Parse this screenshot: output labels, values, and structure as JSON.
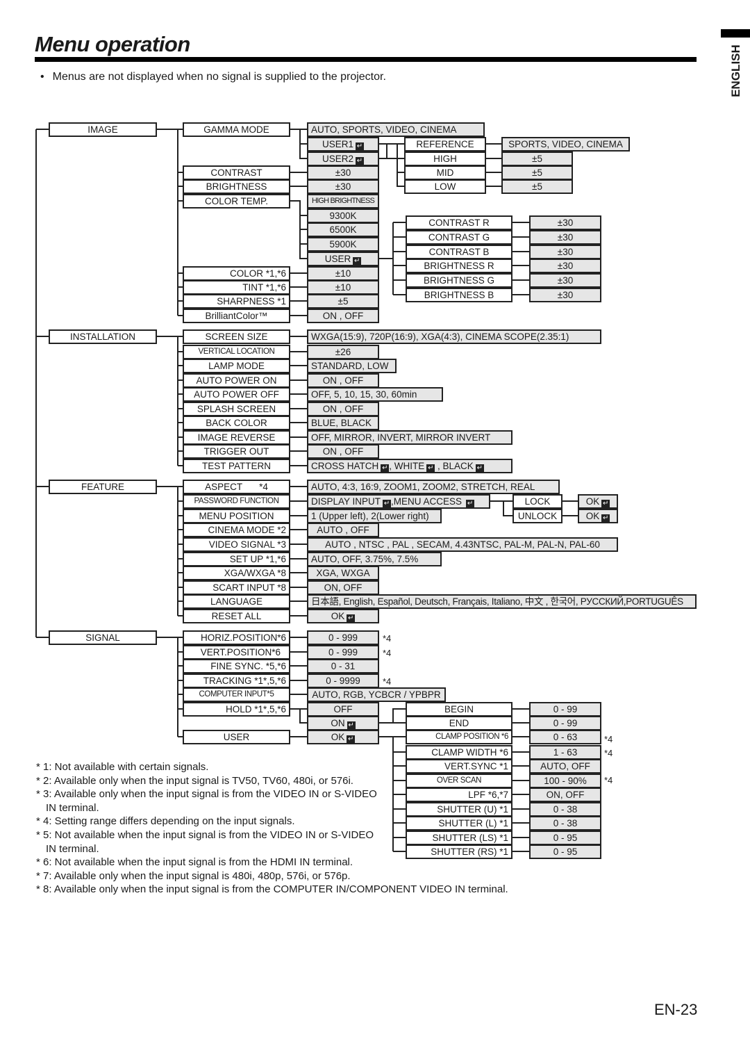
{
  "page": {
    "title": "Menu operation",
    "language_tab": "ENGLISH",
    "intro_bullet": "•",
    "intro": "Menus are not displayed when no signal is supplied to the projector.",
    "page_number": "EN-23",
    "enter_icon": "↵"
  },
  "menus": {
    "image": {
      "label": "IMAGE",
      "items": [
        {
          "label": "GAMMA MODE",
          "value": "AUTO, SPORTS, VIDEO, CINEMA"
        },
        {
          "label": "",
          "value": "USER1"
        },
        {
          "label": "",
          "value": "USER2"
        },
        {
          "label": "CONTRAST",
          "value": "±30"
        },
        {
          "label": "BRIGHTNESS",
          "value": "±30"
        },
        {
          "label": "COLOR TEMP.",
          "value": "HIGH BRIGHTNESS"
        },
        {
          "label": "",
          "value": "9300K"
        },
        {
          "label": "",
          "value": "6500K"
        },
        {
          "label": "",
          "value": "5900K"
        },
        {
          "label": "",
          "value": "USER"
        },
        {
          "label": "COLOR   *1,*6",
          "value": "±10"
        },
        {
          "label": "TINT      *1,*6",
          "value": "±10"
        },
        {
          "label": "SHARPNESS  *1",
          "value": "±5"
        },
        {
          "label": "BrilliantColor™",
          "value": "ON , OFF"
        }
      ],
      "gamma_user": [
        {
          "label": "REFERENCE",
          "value": "SPORTS, VIDEO, CINEMA"
        },
        {
          "label": "HIGH",
          "value": "±5"
        },
        {
          "label": "MID",
          "value": "±5"
        },
        {
          "label": "LOW",
          "value": "±5"
        }
      ],
      "color_temp_user": [
        {
          "label": "CONTRAST R",
          "value": "±30"
        },
        {
          "label": "CONTRAST G",
          "value": "±30"
        },
        {
          "label": "CONTRAST B",
          "value": "±30"
        },
        {
          "label": "BRIGHTNESS R",
          "value": "±30"
        },
        {
          "label": "BRIGHTNESS G",
          "value": "±30"
        },
        {
          "label": "BRIGHTNESS B",
          "value": "±30"
        }
      ]
    },
    "installation": {
      "label": "INSTALLATION",
      "items": [
        {
          "label": "SCREEN SIZE",
          "value": "WXGA(15:9), 720P(16:9), XGA(4:3), CINEMA SCOPE(2.35:1)"
        },
        {
          "label": "VERTICAL LOCATION",
          "value": "±26"
        },
        {
          "label": "LAMP MODE",
          "value": "STANDARD, LOW"
        },
        {
          "label": "AUTO POWER ON",
          "value": "ON , OFF"
        },
        {
          "label": "AUTO POWER OFF",
          "value": "OFF,  5,  10,  15,  30,  60min"
        },
        {
          "label": "SPLASH SCREEN",
          "value": "ON , OFF"
        },
        {
          "label": "BACK COLOR",
          "value": "BLUE, BLACK"
        },
        {
          "label": "IMAGE REVERSE",
          "value": "OFF, MIRROR, INVERT, MIRROR INVERT"
        },
        {
          "label": "TRIGGER OUT",
          "value": "ON , OFF"
        },
        {
          "label": "TEST PATTERN",
          "value_parts": [
            "CROSS HATCH",
            ", WHITE",
            " , BLACK"
          ]
        }
      ]
    },
    "feature": {
      "label": "FEATURE",
      "items": [
        {
          "label": "ASPECT",
          "note": "*4",
          "value": "AUTO, 4:3, 16:9, ZOOM1, ZOOM2, STRETCH, REAL"
        },
        {
          "label": "PASSWORD FUNCTION",
          "value_parts": [
            "DISPLAY INPUT",
            ",MENU ACCESS"
          ]
        },
        {
          "label": "MENU POSITION",
          "value": "1 (Upper left), 2(Lower right)"
        },
        {
          "label": "CINEMA MODE *2",
          "value": "AUTO , OFF"
        },
        {
          "label": "VIDEO SIGNAL *3",
          "value": "AUTO , NTSC , PAL , SECAM, 4.43NTSC, PAL-M, PAL-N, PAL-60"
        },
        {
          "label": "SET UP   *1,*6",
          "value": "AUTO, OFF, 3.75%, 7.5%"
        },
        {
          "label": "XGA/WXGA  *8",
          "value": "XGA, WXGA"
        },
        {
          "label": "SCART INPUT *8",
          "value": "ON, OFF"
        },
        {
          "label": "LANGUAGE",
          "value": "日本語, English, Español, Deutsch, Français, Italiano, 中文 , 한국어, РУССКИЙ,PORTUGUÊS"
        },
        {
          "label": "RESET ALL",
          "value": "OK"
        }
      ],
      "password": [
        {
          "label": "LOCK",
          "value": "OK"
        },
        {
          "label": "UNLOCK",
          "value": "OK"
        }
      ]
    },
    "signal": {
      "label": "SIGNAL",
      "items": [
        {
          "label": "HORIZ.POSITION*6",
          "value": "0 - 999",
          "note": "*4"
        },
        {
          "label": "VERT.POSITION*6",
          "value": "0 - 999",
          "note": "*4"
        },
        {
          "label": "FINE SYNC. *5,*6",
          "value": "0 - 31",
          "note": ""
        },
        {
          "label": "TRACKING *1*,5,*6",
          "value": "0 - 9999",
          "note": "*4"
        },
        {
          "label": "COMPUTER INPUT*5",
          "value": "AUTO, RGB, YCBCR / YPBPR"
        },
        {
          "label": "HOLD *1*,5,*6",
          "value": "OFF"
        },
        {
          "label": "",
          "value": "ON"
        },
        {
          "label": "USER",
          "value": "OK"
        }
      ],
      "user_items": [
        {
          "label": "BEGIN",
          "value": "0 - 99",
          "note": ""
        },
        {
          "label": "END",
          "value": "0 - 99",
          "note": ""
        },
        {
          "label": "CLAMP POSITION *6",
          "value": "0 - 63",
          "note": "*4"
        },
        {
          "label": "CLAMP WIDTH *6",
          "value": "1 - 63",
          "note": "*4"
        },
        {
          "label": "VERT.SYNC     *1",
          "value": "AUTO, OFF",
          "note": ""
        },
        {
          "label": "OVER SCAN",
          "value": "100 - 90%",
          "note": "*4"
        },
        {
          "label": "LPF        *6,*7",
          "value": "ON, OFF",
          "note": ""
        },
        {
          "label": "SHUTTER (U)   *1",
          "value": "0 - 38",
          "note": ""
        },
        {
          "label": "SHUTTER (L)   *1",
          "value": "0 - 38",
          "note": ""
        },
        {
          "label": "SHUTTER (LS)  *1",
          "value": "0 - 95",
          "note": ""
        },
        {
          "label": "SHUTTER (RS)  *1",
          "value": "0 - 95",
          "note": ""
        }
      ]
    }
  },
  "footnotes": [
    "* 1: Not available with certain signals.",
    "* 2: Available only when the input signal is TV50, TV60, 480i, or 576i.",
    "* 3: Available only when the input signal is from the VIDEO IN or S-VIDEO IN terminal.",
    "* 4: Setting range differs depending on the input signals.",
    "* 5: Not available when the input signal is from the VIDEO IN or S-VIDEO IN terminal.",
    "* 6: Not available when the input signal is from the HDMI IN terminal.",
    "* 7: Available only when the input signal is 480i, 480p, 576i, or 576p.",
    "* 8: Available only when the input signal is from the COMPUTER IN/COMPONENT VIDEO IN terminal."
  ]
}
